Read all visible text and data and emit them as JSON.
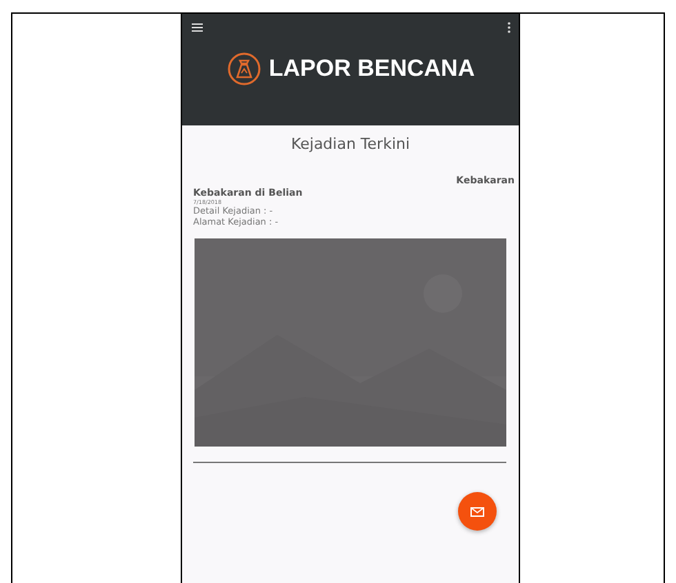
{
  "app_bar": {
    "title": "LAPOR BENCANA"
  },
  "section_title": "Kejadian Terkini",
  "report": {
    "category": "Kebakaran",
    "title": "Kebakaran di Belian",
    "date": "7/18/2018",
    "detail": "Detail Kejadian : -",
    "address": "Alamat Kejadian : -"
  }
}
